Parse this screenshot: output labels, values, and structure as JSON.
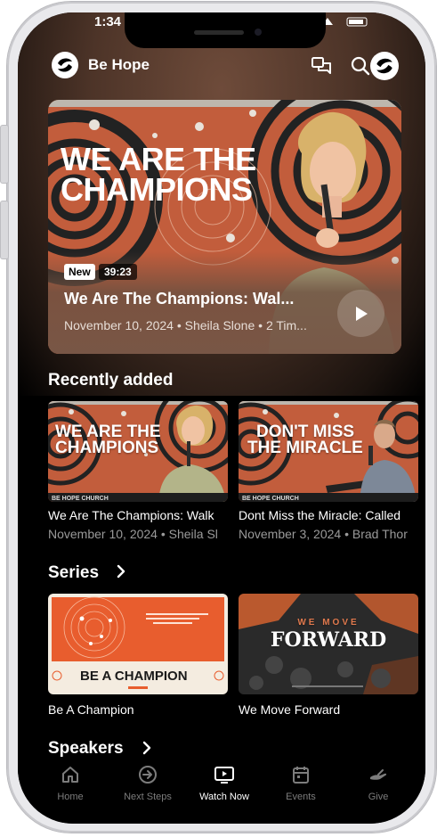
{
  "status": {
    "time": "1:34"
  },
  "app": {
    "title": "Be Hope"
  },
  "hero": {
    "art_title_line1": "WE ARE THE",
    "art_title_line2": "CHAMPIONS",
    "badge": "New",
    "duration": "39:23",
    "title": "We Are The Champions: Wal...",
    "meta": "November 10, 2024 • Sheila Slone • 2 Tim..."
  },
  "recently_added": {
    "heading": "Recently added",
    "items": [
      {
        "art_line1": "WE ARE THE",
        "art_line2": "CHAMPIONS",
        "title": "We Are The Champions: Walk",
        "meta": "November 10, 2024 • Sheila Sl"
      },
      {
        "art_line1": "DON'T MISS",
        "art_line2": "THE MIRACLE",
        "title": "Dont Miss the Miracle: Called",
        "meta": "November 3, 2024 • Brad Thor"
      }
    ]
  },
  "series": {
    "heading": "Series",
    "items": [
      {
        "art": "BE A CHAMPION",
        "title": "Be A Champion"
      },
      {
        "art_line1": "WE MOVE",
        "art_line2": "FORWARD",
        "title": "We Move Forward"
      }
    ]
  },
  "speakers": {
    "heading": "Speakers"
  },
  "tabs": [
    {
      "label": "Home",
      "icon": "home-icon",
      "active": false
    },
    {
      "label": "Next Steps",
      "icon": "arrow-circle-icon",
      "active": false
    },
    {
      "label": "Watch Now",
      "icon": "tv-play-icon",
      "active": true
    },
    {
      "label": "Events",
      "icon": "calendar-icon",
      "active": false
    },
    {
      "label": "Give",
      "icon": "hand-give-icon",
      "active": false
    }
  ],
  "colors": {
    "accent_orange": "#d9603a",
    "tab_active": "#ffffff",
    "tab_inactive": "#7c7c7c"
  }
}
